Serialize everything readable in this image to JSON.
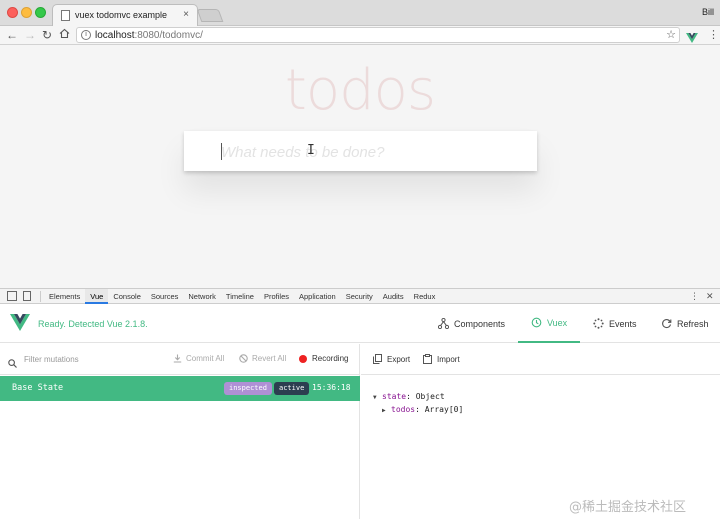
{
  "browser": {
    "tab_title": "vuex todomvc example",
    "tab_close": "×",
    "user": "Bill",
    "url_host": "localhost",
    "url_rest": ":8080/todomvc/"
  },
  "app": {
    "title": "todos",
    "new_todo_placeholder": "What needs to be done?"
  },
  "devtools": {
    "tabs": [
      "Elements",
      "Vue",
      "Console",
      "Sources",
      "Network",
      "Timeline",
      "Profiles",
      "Application",
      "Security",
      "Audits",
      "Redux"
    ],
    "active_tab": "Vue",
    "more": "⋮",
    "close": "✕"
  },
  "vue": {
    "status": "Ready. Detected Vue 2.1.8.",
    "nav": {
      "components": "Components",
      "vuex": "Vuex",
      "events": "Events",
      "refresh": "Refresh"
    },
    "mutations": {
      "filter_placeholder": "Filter mutations",
      "commit_all": "Commit All",
      "revert_all": "Revert All",
      "recording": "Recording"
    },
    "base_state": {
      "name": "Base State",
      "badge_inspected": "inspected",
      "badge_active": "active",
      "time": "15:36:18"
    },
    "state_panel": {
      "export": "Export",
      "import": "Import",
      "tree": [
        {
          "key": "state",
          "value": "Object",
          "expanded": true,
          "depth": 0
        },
        {
          "key": "todos",
          "value": "Array[0]",
          "expanded": false,
          "depth": 1
        }
      ]
    }
  },
  "watermark": "@稀土掘金技术社区",
  "colors": {
    "vue_green": "#42b983",
    "badge_inspected": "#af90d5",
    "badge_active": "#2c3e50",
    "record_red": "#ee2222"
  }
}
